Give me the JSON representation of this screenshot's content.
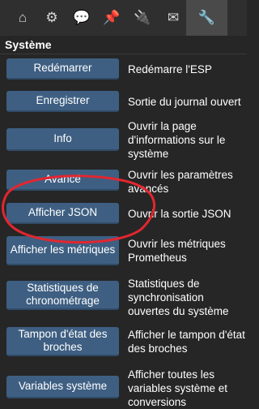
{
  "tabs": [
    {
      "name": "home-icon",
      "glyph": "⌂"
    },
    {
      "name": "gear-icon",
      "glyph": "⚙"
    },
    {
      "name": "chat-icon",
      "glyph": "💬"
    },
    {
      "name": "pin-icon",
      "glyph": "📌"
    },
    {
      "name": "plug-icon",
      "glyph": "🔌"
    },
    {
      "name": "mail-icon",
      "glyph": "✉"
    },
    {
      "name": "wrench-icon",
      "glyph": "🔧"
    }
  ],
  "section": {
    "title": "Système"
  },
  "rows": [
    {
      "button": "Redémarrer",
      "description": "Redémarre l'ESP"
    },
    {
      "button": "Enregistrer",
      "description": "Sortie du journal ouvert"
    },
    {
      "button": "Info",
      "description": "Ouvrir la page d'informations sur le système"
    },
    {
      "button": "Avancé",
      "description": "Ouvrir les paramètres avancés"
    },
    {
      "button": "Afficher JSON",
      "description": "Ouvrir la sortie JSON"
    },
    {
      "button": "Afficher les métriques",
      "description": "Ouvrir les métriques Prometheus"
    },
    {
      "button": "Statistiques de chronométrage",
      "description": "Statistiques de synchronisation ouvertes du système"
    },
    {
      "button": "Tampon d'état des broches",
      "description": "Afficher le tampon d'état des broches"
    },
    {
      "button": "Variables système",
      "description": "Afficher toutes les variables système et conversions"
    }
  ],
  "colors": {
    "accent": "#3e5f82",
    "annotation": "#e3262f",
    "background": "#262626"
  }
}
